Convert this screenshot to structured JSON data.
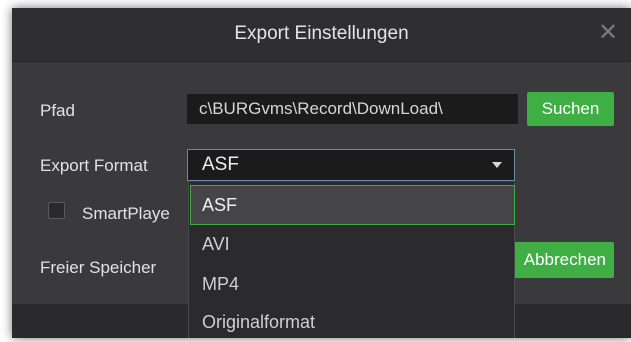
{
  "dialog": {
    "title": "Export Einstellungen",
    "close_glyph": "✕"
  },
  "path": {
    "label": "Pfad",
    "value": "c\\BURGvms\\Record\\DownLoad\\",
    "browse_label": "Suchen"
  },
  "format": {
    "label": "Export Format",
    "selected": "ASF",
    "options": [
      "ASF",
      "AVI",
      "MP4",
      "Originalformat"
    ]
  },
  "smartplayer": {
    "label": "SmartPlaye",
    "checked": false
  },
  "storage": {
    "label": "Freier Speicher"
  },
  "cancel_label": "Abbrechen",
  "colors": {
    "accent": "#3eae45",
    "background": "#3a3a3d",
    "titlebar": "#2f2f31",
    "field": "#1b1b1c"
  },
  "icons": {
    "close": "close-icon",
    "dropdown": "chevron-down-icon"
  }
}
